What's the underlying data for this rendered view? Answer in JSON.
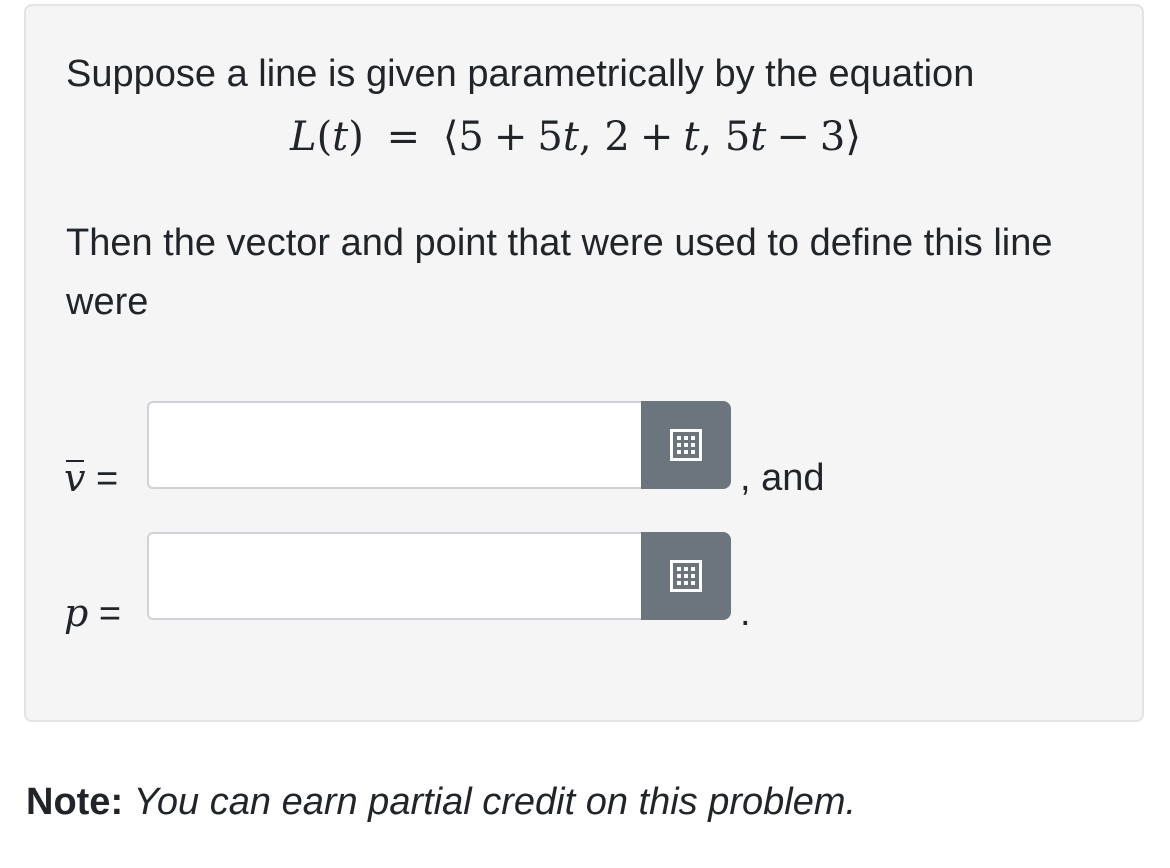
{
  "problem": {
    "intro": "Suppose a line is given parametrically by the equation",
    "equation": {
      "lhs_func": "L",
      "lhs_var": "t",
      "equals": "=",
      "open_bracket": "⟨",
      "comp1_a": "5",
      "comp1_op": "+",
      "comp1_b": "5",
      "comp1_var": "t",
      "comma1": ",",
      "comp2_a": "2",
      "comp2_op": "+",
      "comp2_var": "t",
      "comma2": ",",
      "comp3_a": "5",
      "comp3_var": "t",
      "comp3_op": "−",
      "comp3_b": "3",
      "close_bracket": "⟩"
    },
    "question": "Then the vector and point that were used to define this line were"
  },
  "answers": {
    "vector": {
      "symbol": "v",
      "equals": "=",
      "value": "",
      "after_text": ", and",
      "button_icon": "matrix-grid-icon"
    },
    "point": {
      "symbol": "p",
      "equals": "=",
      "value": "",
      "after_text": ".",
      "button_icon": "matrix-grid-icon"
    }
  },
  "note": {
    "label": "Note:",
    "text": "You can earn partial credit on this problem."
  },
  "colors": {
    "card_background": "#f5f5f5",
    "card_border": "#e3e3e3",
    "button_background": "#6c757d",
    "text": "#212529"
  }
}
